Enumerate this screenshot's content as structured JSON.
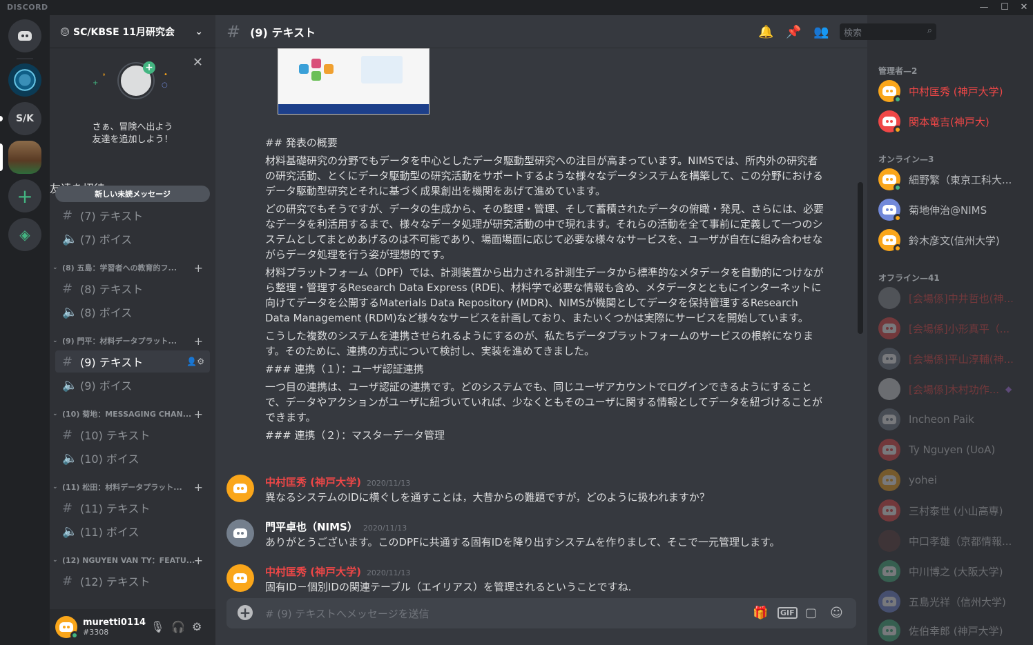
{
  "app": {
    "brand": "DISCORD"
  },
  "colors": {
    "accent": "#7289da",
    "online": "#43b581",
    "admin_name": "#f04747",
    "orange": "#faa61a"
  },
  "guilds": {
    "sk_label": "S/K"
  },
  "server": {
    "name": "SC/KBSE 11月研究会"
  },
  "friend_card": {
    "line1": "さぁ、冒険へ出よう",
    "line2": "友達を追加しよう！",
    "invite_label": "友達を招待"
  },
  "unread_label": "新しい未読メッセージ",
  "channels": {
    "c7_text": "(7) テキスト",
    "c7_voice": "(7) ボイス",
    "cat8": "(8) 五島：学習者への教育的フ...",
    "c8_text": "(8) テキスト",
    "c8_voice": "(8) ボイス",
    "cat9": "(9) 門平：材料データプラット...",
    "c9_text": "(9) テキスト",
    "c9_voice": "(9) ボイス",
    "cat10": "(10) 菊地：MESSAGING CHAN...",
    "c10_text": "(10) テキスト",
    "c10_voice": "(10) ボイス",
    "cat11": "(11) 松田：材料データプラット...",
    "c11_text": "(11) テキスト",
    "c11_voice": "(11) ボイス",
    "cat12": "(12) NGUYEN VAN TY：FEATU...",
    "c12_text": "(12) テキスト"
  },
  "user": {
    "name": "muretti0114",
    "tag": "#3308"
  },
  "header": {
    "channel_title": "(9) テキスト",
    "search_placeholder": "検索"
  },
  "post": {
    "h2": "## 発表の概要",
    "p1": "材料基礎研究の分野でもデータを中心としたデータ駆動型研究への注目が高まっています。NIMSでは、所内外の研究者の研究活動、とくにデータ駆動型の研究活動をサポートするような様々なデータシステムを構築して、この分野におけるデータ駆動型研究とそれに基づく成果創出を機関をあげて進めています。",
    "p2": "どの研究でもそうですが、データの生成から、その整理・管理、そして蓄積されたデータの俯瞰・発見、さらには、必要なデータを利活用するまで、様々なデータ処理が研究活動の中で現れます。それらの活動を全て事前に定義して一つのシステムとしてまとめあげるのは不可能であり、場面場面に応じて必要な様々なサービスを、ユーザが自在に組み合わせながらデータ処理を行う姿が理想的です。",
    "p3": "材料プラットフォーム（DPF）では、計測装置から出力される計測生データから標準的なメタデータを自動的につけながら整理・管理するResearch Data Express (RDE)、材料学で必要な情報も含め、メタデータとともにインターネットに向けてデータを公開するMaterials Data Repository (MDR)、NIMSが機関としてデータを保持管理するResearch Data Management (RDM)など様々なサービスを計画しており、またいくつかは実際にサービスを開始しています。",
    "p4": "こうした複数のシステムを連携させられるようにするのが、私たちデータプラットフォームのサービスの根幹になります。そのために、連携の方式について検討し、実装を進めてきました。",
    "h3a": "### 連携（１）：ユーザ認証連携",
    "p5": "一つ目の連携は、ユーザ認証の連携です。どのシステムでも、同じユーザアカウントでログインできるようにすることで、データやアクションがユーザに紐づいていれば、少なくともそのユーザに関する情報としてデータを紐づけることができます。",
    "h3b": "### 連携（２）：マスターデータ管理"
  },
  "messages": [
    {
      "author": "中村匡秀 (神戸大学)",
      "time": "2020/11/13",
      "text": "異なるシステムのIDに横ぐしを通すことは，大昔からの難題ですが，どのように扱われますか？"
    },
    {
      "author": "門平卓也（NIMS）",
      "time": "2020/11/13",
      "text": "ありがとうございます。このDPFに共通する固有IDを降り出すシステムを作りまして、そこで一元管理します。"
    },
    {
      "author": "中村匡秀 (神戸大学)",
      "time": "2020/11/13",
      "text": "固有ID－個別IDの関連テーブル（エイリアス）を管理されるということですね."
    }
  ],
  "composer": {
    "placeholder": "# (9) テキストへメッセージを送信",
    "gif": "GIF"
  },
  "members": {
    "admins_label": "管理者—2",
    "online_label": "オンライン—3",
    "offline_label": "オフライン—41",
    "admins": [
      "中村匡秀 (神戸大学)",
      "関本竜吉(神戸大)"
    ],
    "online": [
      "細野繁（東京工科大...",
      "菊地伸治@NIMS",
      "鈴木彦文(信州大学)"
    ],
    "offline": [
      "[会場係]中井哲也(神...",
      "[会場係]小形真平（...",
      "[会場係]平山淳輔(神...",
      "[会場係]木村功作...",
      "Incheon Paik",
      "Ty Nguyen (UoA)",
      "yohei",
      "三村泰世 (小山高専)",
      "中口孝雄（京都情報...",
      "中川博之 (大阪大学)",
      "五島光祥（信州大学)",
      "佐伯幸郎 (神戸大学)"
    ]
  }
}
